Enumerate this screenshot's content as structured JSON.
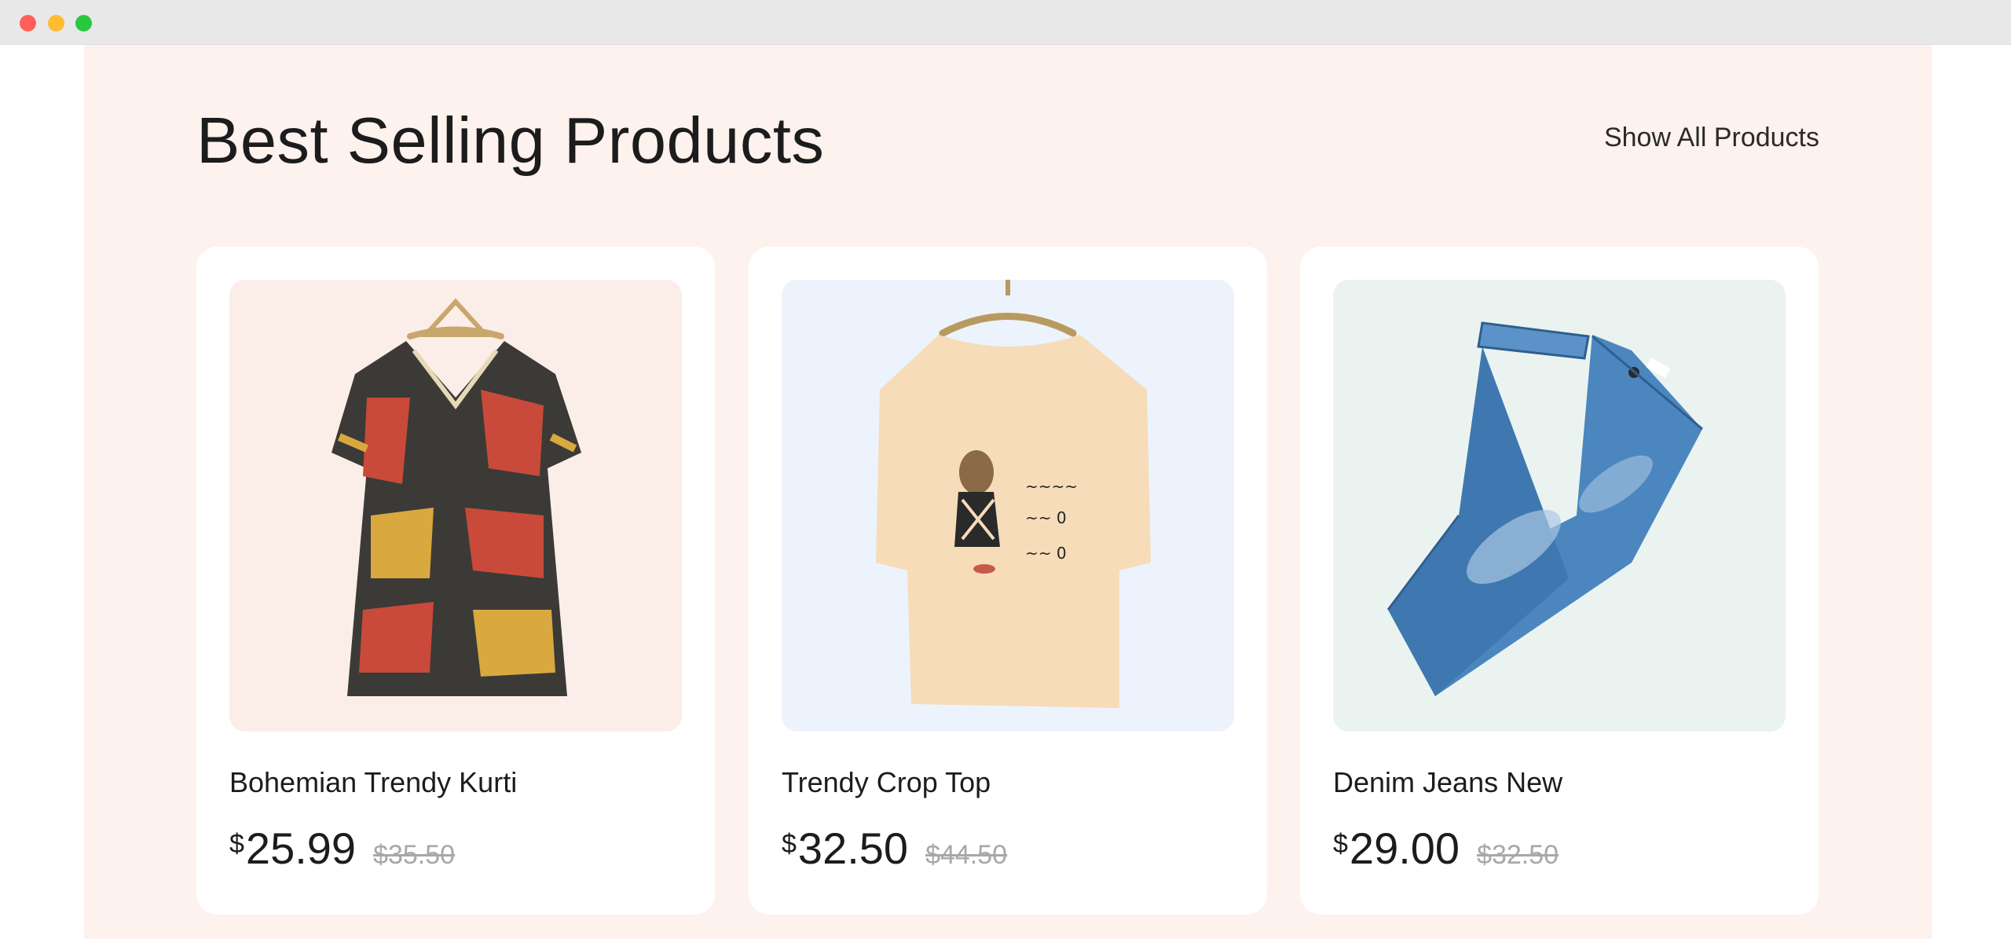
{
  "section": {
    "title": "Best Selling Products",
    "show_all_label": "Show All Products"
  },
  "products": [
    {
      "name": "Bohemian Trendy Kurti",
      "currency": "$",
      "price": "25.99",
      "old_price": "$35.50",
      "image": "patterned-kurti-on-hanger"
    },
    {
      "name": "Trendy Crop Top",
      "currency": "$",
      "price": "32.50",
      "old_price": "$44.50",
      "image": "cream-top-on-hanger"
    },
    {
      "name": "Denim Jeans New",
      "currency": "$",
      "price": "29.00",
      "old_price": "$32.50",
      "image": "folded-blue-jeans"
    }
  ],
  "colors": {
    "section_bg": "#fdf2ed",
    "card_bg": "#ffffff",
    "old_price": "#a8a8a8"
  }
}
